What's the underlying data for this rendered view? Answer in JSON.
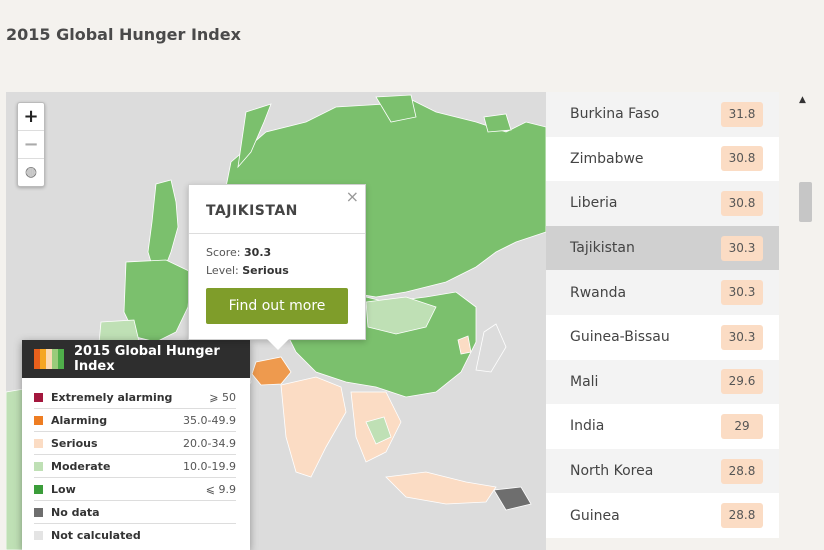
{
  "page": {
    "title": "2015 Global Hunger Index"
  },
  "zoom": {
    "in_label": "+",
    "out_label": "−",
    "globe_label": "◍"
  },
  "popup": {
    "close_label": "×",
    "country": "TAJIKISTAN",
    "score_label": "Score:",
    "score_value": "30.3",
    "level_label": "Level:",
    "level_value": "Serious",
    "button_label": "Find out more"
  },
  "legend": {
    "title": "2015 Global Hunger Index",
    "logo_colors": [
      "#e8601c",
      "#f5a623",
      "#fbd9b3",
      "#9acb7a",
      "#4fae4a"
    ],
    "items": [
      {
        "label": "Extremely alarming",
        "range": "⩾ 50",
        "color": "#a3173d"
      },
      {
        "label": "Alarming",
        "range": "35.0-49.9",
        "color": "#ee7d22"
      },
      {
        "label": "Serious",
        "range": "20.0-34.9",
        "color": "#fbdcc4"
      },
      {
        "label": "Moderate",
        "range": "10.0-19.9",
        "color": "#bfe0b5"
      },
      {
        "label": "Low",
        "range": "⩽ 9.9",
        "color": "#3b9d3a"
      },
      {
        "label": "No data",
        "range": "",
        "color": "#6e6e6e"
      },
      {
        "label": "Not calculated",
        "range": "",
        "color": "#e4e4e4"
      }
    ]
  },
  "countries": [
    {
      "name": "Burkina Faso",
      "score": "31.8"
    },
    {
      "name": "Zimbabwe",
      "score": "30.8"
    },
    {
      "name": "Liberia",
      "score": "30.8"
    },
    {
      "name": "Tajikistan",
      "score": "30.3",
      "selected": true
    },
    {
      "name": "Rwanda",
      "score": "30.3"
    },
    {
      "name": "Guinea-Bissau",
      "score": "30.3"
    },
    {
      "name": "Mali",
      "score": "29.6"
    },
    {
      "name": "India",
      "score": "29"
    },
    {
      "name": "North Korea",
      "score": "28.8"
    },
    {
      "name": "Guinea",
      "score": "28.8"
    }
  ],
  "scrollbar": {
    "up_arrow": "▲"
  },
  "colors": {
    "low": "#7bc06d",
    "moderate": "#bfe0b5",
    "serious": "#fbdcc4",
    "alarming": "#ee9a4e",
    "no_data": "#6e6e6e",
    "not_calculated": "#dcdcdc",
    "border": "#ffffff"
  }
}
